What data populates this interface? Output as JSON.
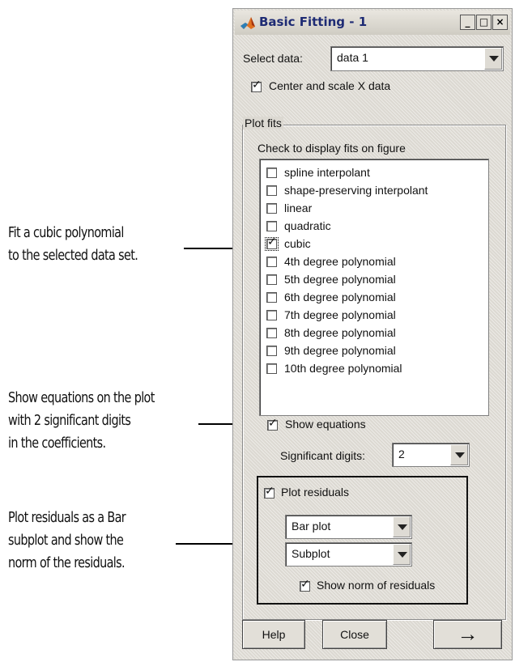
{
  "annotations": [
    "Fit a cubic polynomial\nto the selected data set.",
    "Show equations on the plot\nwith 2 significant digits\nin the coefficients.",
    "Plot residuals as a Bar\nsubplot and show the\nnorm of the residuals."
  ],
  "window": {
    "title": "Basic Fitting - 1",
    "title_icon": "matlab-icon",
    "controls": {
      "minimize": "_",
      "maximize": "□",
      "close": "×"
    }
  },
  "select_data": {
    "label": "Select data:",
    "value": "data 1"
  },
  "center_scale": {
    "label": "Center and scale X data",
    "checked": true
  },
  "plot_fits": {
    "legend": "Plot fits",
    "hint": "Check to display fits on figure",
    "items": [
      {
        "label": "spline interpolant",
        "checked": false
      },
      {
        "label": "shape-preserving interpolant",
        "checked": false
      },
      {
        "label": "linear",
        "checked": false
      },
      {
        "label": "quadratic",
        "checked": false
      },
      {
        "label": "cubic",
        "checked": true
      },
      {
        "label": "4th degree polynomial",
        "checked": false
      },
      {
        "label": "5th degree polynomial",
        "checked": false
      },
      {
        "label": "6th degree polynomial",
        "checked": false
      },
      {
        "label": "7th degree polynomial",
        "checked": false
      },
      {
        "label": "8th degree polynomial",
        "checked": false
      },
      {
        "label": "9th degree polynomial",
        "checked": false
      },
      {
        "label": "10th degree polynomial",
        "checked": false
      }
    ]
  },
  "show_equations": {
    "label": "Show equations",
    "checked": true
  },
  "significant_digits": {
    "label": "Significant digits:",
    "value": "2"
  },
  "residuals": {
    "label": "Plot residuals",
    "checked": true,
    "plot_style": "Bar plot",
    "plot_location": "Subplot",
    "show_norm": {
      "label": "Show norm of residuals",
      "checked": true
    }
  },
  "buttons": {
    "help": "Help",
    "close": "Close",
    "next": "→"
  }
}
